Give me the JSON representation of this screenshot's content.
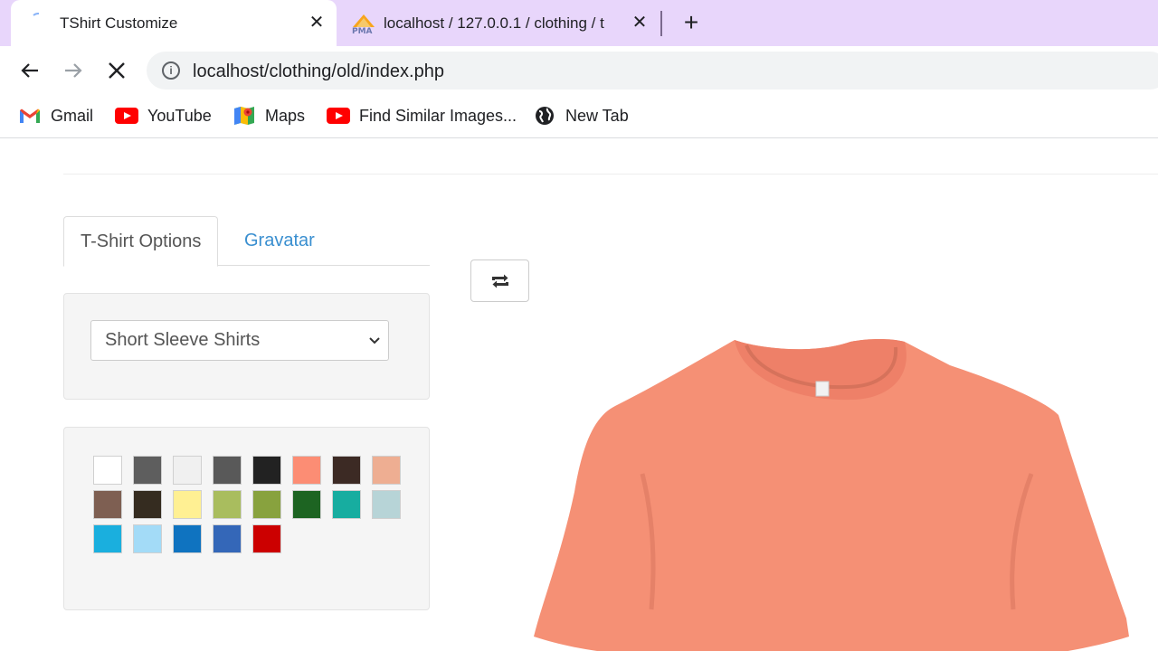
{
  "browser": {
    "tabs": [
      {
        "title": "TShirt Customize",
        "active": true
      },
      {
        "title": "localhost / 127.0.0.1 / clothing / t",
        "active": false,
        "favicon_text": "PMA"
      }
    ],
    "tab_close_glyph": "✕",
    "new_tab_glyph": "+",
    "url": "localhost/clothing/old/index.php",
    "info_glyph": "i",
    "bookmarks": [
      {
        "label": "Gmail",
        "icon": "gmail-icon"
      },
      {
        "label": "YouTube",
        "icon": "youtube-icon"
      },
      {
        "label": "Maps",
        "icon": "maps-icon"
      },
      {
        "label": "Find Similar Images...",
        "icon": "youtube-icon"
      },
      {
        "label": "New Tab",
        "icon": "globe-icon"
      }
    ]
  },
  "customizer": {
    "tabs": [
      "T-Shirt Options",
      "Gravatar"
    ],
    "shirt_type": "Short Sleeve Shirts",
    "shirt_color": "#f59075",
    "swatches": [
      "#ffffff",
      "#5e5e5e",
      "#f0f0f0",
      "#595959",
      "#222222",
      "#fc8d74",
      "#3c2a24",
      "#eeae92",
      "#7e5f52",
      "#352c20",
      "#fff093",
      "#a9bd5e",
      "#88a23e",
      "#1d6422",
      "#17ada0",
      "#b7d4d7",
      "#1aafde",
      "#a3dbf7",
      "#0f73c0",
      "#3467b8",
      "#cc0000"
    ]
  }
}
